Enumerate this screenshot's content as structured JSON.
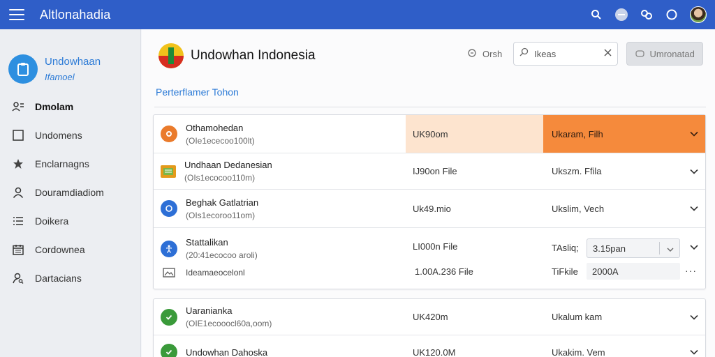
{
  "app": {
    "title": "Altlonahadia"
  },
  "profile": {
    "name": "Undowhaan",
    "subtitle": "Ifamoel"
  },
  "sidebar": {
    "items": [
      {
        "label": "Dmolam",
        "icon": "users-icon",
        "active": true
      },
      {
        "label": "Undomens",
        "icon": "square-icon",
        "active": false
      },
      {
        "label": "Enclarnagns",
        "icon": "star-icon",
        "active": false
      },
      {
        "label": "Douramdiadiom",
        "icon": "person-icon",
        "active": false
      },
      {
        "label": "Doikera",
        "icon": "list-icon",
        "active": false
      },
      {
        "label": "Cordownea",
        "icon": "calendar-icon",
        "active": false
      },
      {
        "label": "Dartacians",
        "icon": "person-search-icon",
        "active": false
      }
    ]
  },
  "header": {
    "title": "Undowhan Indonesia",
    "clear_label": "Orsh",
    "search_value": "Ikeas",
    "primary_button": "Umronatad",
    "breadcrumb": "Perterflamer Tohon"
  },
  "rows": [
    {
      "title": "Othamohedan",
      "sub": "(OIe1ececoo100lt)",
      "size": "UK90om",
      "type": "Ukaram,  Filh",
      "icon_color": "#ea7b2c",
      "icon": "record-icon",
      "highlighted": true
    },
    {
      "title": "Undhaan Dedanesian",
      "sub": "(OIs1ecocoo110m)",
      "size": "IJ90on File",
      "type": "Ukszm.  Ffila",
      "icon_color": "#e39a1b",
      "icon": "document-icon",
      "highlighted": false
    },
    {
      "title": "Beghak Gatlatrian",
      "sub": "(OIs1ecoroo11om)",
      "size": "Uk49.mio",
      "type": "Ukslim,  Vech",
      "icon_color": "#2d6fd6",
      "icon": "info-icon",
      "highlighted": false
    },
    {
      "title": "Stattalikan",
      "sub": "(20:41ecocoo aroli)",
      "size": "LI000n File",
      "type": "TAsliq;",
      "icon_color": "#2d6fd6",
      "icon": "accessibility-icon",
      "highlighted": false,
      "select_value": "3.15pan"
    },
    {
      "title": "Ideamaeocelonl",
      "sub": "",
      "size": "1.00A.236 File",
      "type": "TiFkile",
      "icon_color": "#555",
      "icon": "image-icon",
      "highlighted": false,
      "value": "2000A"
    },
    {
      "title": "Uaranianka",
      "sub": "(OIE1ecooocl60a,oom)",
      "size": "UK420m",
      "type": "Ukalum    kam",
      "icon_color": "#3a9a3a",
      "icon": "check-icon",
      "highlighted": false
    },
    {
      "title": "Undowhan Dahoska",
      "sub": "",
      "size": "UK120.0M",
      "type": "Ukakim.  Vem",
      "icon_color": "#3a9a3a",
      "icon": "check-icon",
      "highlighted": false
    }
  ]
}
